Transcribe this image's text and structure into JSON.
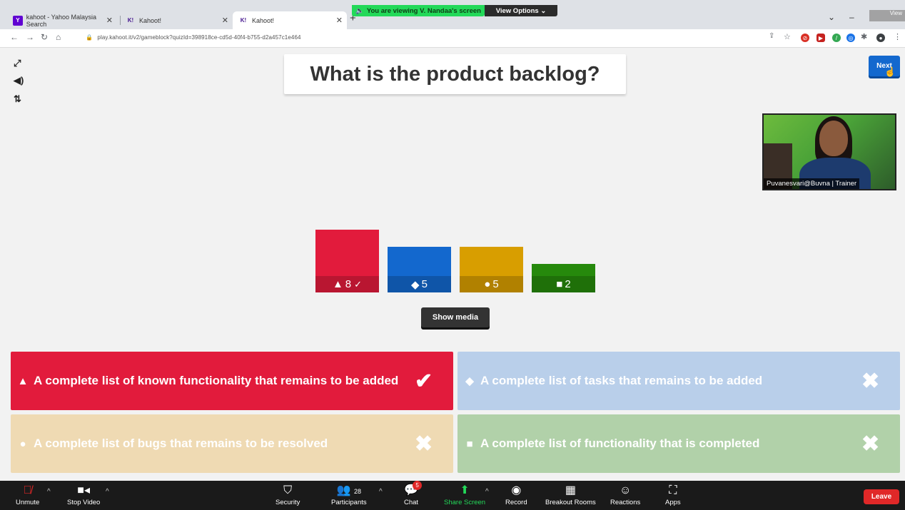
{
  "browser": {
    "tabs": [
      {
        "label": "kahoot - Yahoo Malaysia Search",
        "favicon": "yahoo-icon",
        "active": false
      },
      {
        "label": "Kahoot!",
        "favicon": "kahoot-icon",
        "active": false
      },
      {
        "label": "Kahoot!",
        "favicon": "kahoot-icon",
        "active": true
      }
    ],
    "new_tab": "+",
    "url": "play.kahoot.it/v2/gameblock?quizId=398918ce-cd5d-40f4-b755-d2a457c1e464"
  },
  "zoom_banner": {
    "viewing": "You are viewing V. Nandaa's screen",
    "view_options": "View Options ⌄",
    "view_corner": "View"
  },
  "kahoot": {
    "question": "What is the product backlog?",
    "next_label": "Next",
    "show_media_label": "Show media",
    "bars": [
      {
        "shape": "▲",
        "count": 8,
        "correct_mark": "✓",
        "color": "#e21b3c"
      },
      {
        "shape": "◆",
        "count": 5,
        "correct_mark": "",
        "color": "#1368ce"
      },
      {
        "shape": "●",
        "count": 5,
        "correct_mark": "",
        "color": "#d89e00"
      },
      {
        "shape": "■",
        "count": 2,
        "correct_mark": "",
        "color": "#26890c"
      }
    ],
    "answers": [
      {
        "shape": "▲",
        "text": "A complete list of known functionality that remains to be added",
        "mark": "✔",
        "correct": true
      },
      {
        "shape": "◆",
        "text": "A complete list of tasks that remains to be added",
        "mark": "✖",
        "correct": false
      },
      {
        "shape": "●",
        "text": "A complete list of bugs that remains to be resolved",
        "mark": "✖",
        "correct": false
      },
      {
        "shape": "■",
        "text": "A complete list of functionality that is completed",
        "mark": "✖",
        "correct": false
      }
    ]
  },
  "video": {
    "participant_label": "Puvanesvari@Buvna | Trainer"
  },
  "zoom_toolbar": {
    "unmute": "Unmute",
    "stop_video": "Stop Video",
    "security": "Security",
    "participants": "Participants",
    "participants_count": "28",
    "chat": "Chat",
    "chat_badge": "5",
    "share_screen": "Share Screen",
    "record": "Record",
    "breakout_rooms": "Breakout Rooms",
    "reactions": "Reactions",
    "apps": "Apps",
    "leave": "Leave"
  }
}
